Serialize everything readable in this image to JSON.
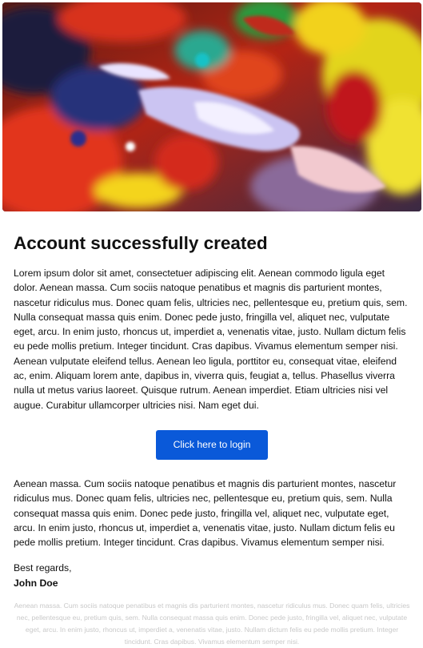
{
  "hero": {
    "image": "abstract-paint-texture"
  },
  "email": {
    "title": "Account successfully created",
    "paragraph_1": "Lorem ipsum dolor sit amet, consectetuer adipiscing elit. Aenean commodo ligula eget dolor. Aenean massa. Cum sociis natoque penatibus et magnis dis parturient montes, nascetur ridiculus mus. Donec quam felis, ultricies nec, pellentesque eu, pretium quis, sem. Nulla consequat massa quis enim. Donec pede justo, fringilla vel, aliquet nec, vulputate eget, arcu. In enim justo, rhoncus ut, imperdiet a, venenatis vitae, justo. Nullam dictum felis eu pede mollis pretium. Integer tincidunt. Cras dapibus. Vivamus elementum semper nisi. Aenean vulputate eleifend tellus. Aenean leo ligula, porttitor eu, consequat vitae, eleifend ac, enim. Aliquam lorem ante, dapibus in, viverra quis, feugiat a, tellus. Phasellus viverra nulla ut metus varius laoreet. Quisque rutrum. Aenean imperdiet. Etiam ultricies nisi vel augue. Curabitur ullamcorper ultricies nisi. Nam eget dui.",
    "login_button_label": "Click here to login",
    "paragraph_2": "Aenean massa. Cum sociis natoque penatibus et magnis dis parturient montes, nascetur ridiculus mus. Donec quam felis, ultricies nec, pellentesque eu, pretium quis, sem. Nulla consequat massa quis enim. Donec pede justo, fringilla vel, aliquet nec, vulputate eget, arcu. In enim justo, rhoncus ut, imperdiet a, venenatis vitae, justo. Nullam dictum felis eu pede mollis pretium. Integer tincidunt. Cras dapibus. Vivamus elementum semper nisi.",
    "closing": "Best regards,",
    "signer": "John Doe"
  },
  "footer": {
    "text": "Aenean massa. Cum sociis natoque penatibus et magnis dis parturient montes, nascetur ridiculus mus. Donec quam felis, ultricies nec, pellentesque eu, pretium quis, sem. Nulla consequat massa quis enim. Donec pede justo, fringilla vel, aliquet nec, vulputate eget, arcu. In enim justo, rhoncus ut, imperdiet a, venenatis vitae, justo. Nullam dictum felis eu pede mollis pretium. Integer tincidunt. Cras dapibus. Vivamus elementum semper nisi."
  },
  "colors": {
    "accent": "#0a59d9",
    "text": "#111111",
    "footer_text": "#c9c9c9"
  }
}
